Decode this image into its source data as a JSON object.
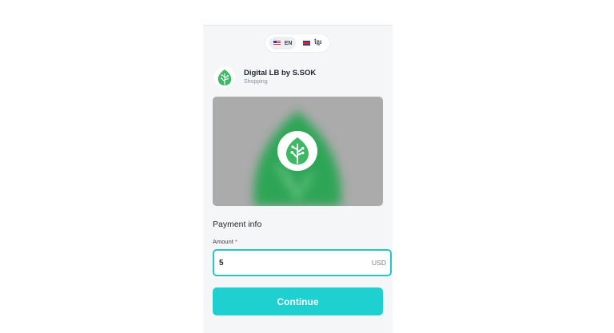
{
  "language": {
    "options": [
      {
        "label": "EN",
        "flag": "us-flag-icon",
        "active": true
      },
      {
        "label": "ខ្មែរ",
        "flag": "cambodia-flag-icon",
        "active": false
      }
    ]
  },
  "merchant": {
    "name": "Digital LB by S.SOK",
    "category": "Shopping",
    "logo_icon": "leaf-icon"
  },
  "payment": {
    "section_title": "Payment info",
    "amount_label": "Amount",
    "required_mark": "*",
    "amount_value": "5",
    "currency": "USD",
    "continue_label": "Continue"
  },
  "colors": {
    "accent": "#1fd0d1",
    "input_border": "#29c3c4",
    "leaf_green": "#3db865",
    "required": "#e0303a"
  }
}
